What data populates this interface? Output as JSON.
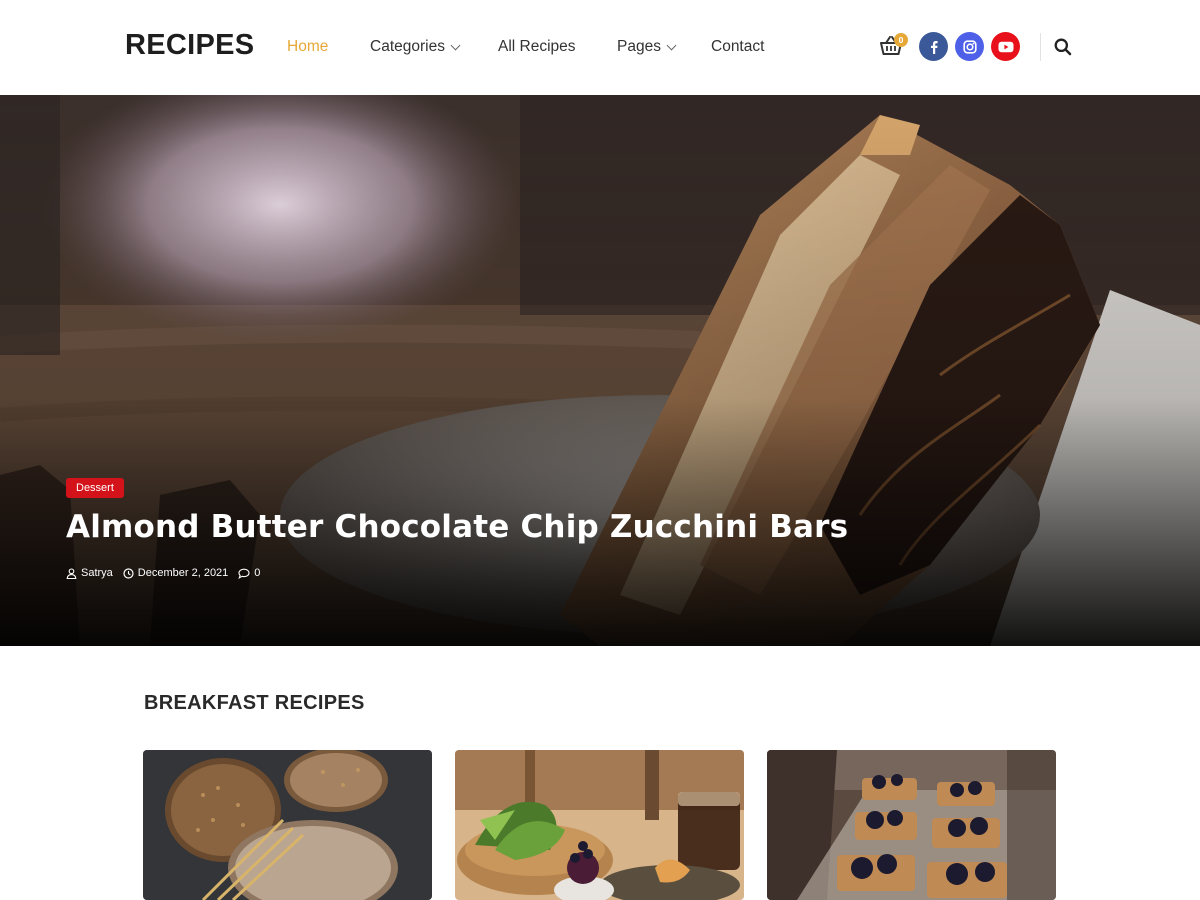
{
  "header": {
    "logo": "RECIPES",
    "nav": [
      {
        "label": "Home",
        "active": true
      },
      {
        "label": "Categories",
        "dropdown": true
      },
      {
        "label": "All Recipes"
      },
      {
        "label": "Pages",
        "dropdown": true
      },
      {
        "label": "Contact"
      }
    ],
    "cart_count": "0",
    "social": [
      "facebook-icon",
      "instagram-icon",
      "youtube-icon"
    ],
    "search_icon": "search-icon"
  },
  "hero": {
    "category": "Dessert",
    "title": "Almond Butter Chocolate Chip Zucchini Bars",
    "author": "Satrya",
    "date": "December 2, 2021",
    "comments": "0"
  },
  "section": {
    "title": "BREAKFAST RECIPES"
  },
  "colors": {
    "accent": "#e6a938",
    "badge": "#d4121a",
    "facebook": "#3b5998",
    "instagram": "#4e60e8",
    "youtube": "#e8101a"
  }
}
